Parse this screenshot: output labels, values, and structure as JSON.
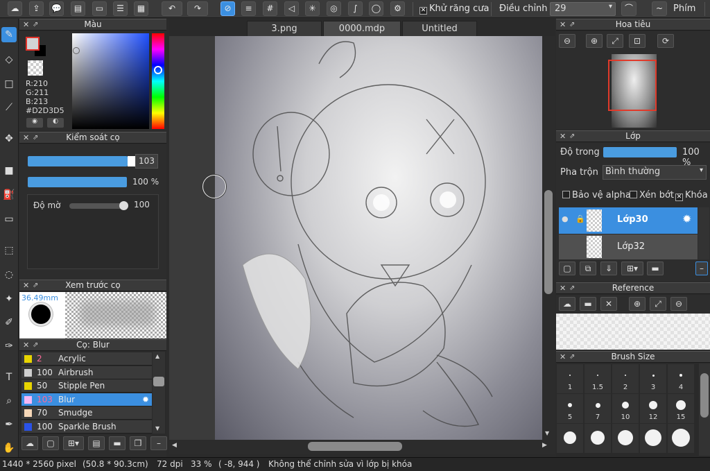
{
  "toolbar": {
    "antialias_label": "Khử răng cưa",
    "adjust_label": "Điều chỉnh",
    "adjust_value": "29",
    "shortcut_label": "Phím"
  },
  "color_panel": {
    "title": "Màu",
    "r_label": "R:210",
    "g_label": "G:211",
    "b_label": "B:213",
    "hex_label": "#D2D3D5",
    "current_color": "#d2d3d5"
  },
  "brush_control": {
    "title": "Kiểm soát cọ",
    "size_value": "103",
    "opacity_value": "100 %",
    "blur_label": "Độ mờ",
    "blur_value": "100"
  },
  "brush_preview": {
    "title": "Xem trước cọ",
    "size_text": "36.49mm"
  },
  "brush_list": {
    "title": "Cọ: Blur",
    "items": [
      {
        "size": "2",
        "name": "Acrylic",
        "color": "#e8d400"
      },
      {
        "size": "100",
        "name": "Airbrush",
        "color": "#cfcfcf"
      },
      {
        "size": "50",
        "name": "Stipple Pen",
        "color": "#e8d400"
      },
      {
        "size": "103",
        "name": "Blur",
        "color": "#f5b8f5",
        "selected": true
      },
      {
        "size": "70",
        "name": "Smudge",
        "color": "#f6d7b8"
      },
      {
        "size": "100",
        "name": "Sparkle Brush",
        "color": "#2a52e8"
      }
    ]
  },
  "tabs": [
    {
      "label": "3.png"
    },
    {
      "label": "0000.mdp",
      "active": true
    },
    {
      "label": "Untitled"
    }
  ],
  "navigator": {
    "title": "Hoa tiêu"
  },
  "layers": {
    "title": "Lớp",
    "opacity_label": "Độ trong",
    "opacity_value": "100 %",
    "blend_label": "Pha trộn",
    "blend_value": "Bình thường",
    "protect_alpha": "Bảo vệ alpha",
    "clipping": "Xén bớt",
    "lock": "Khóa",
    "items": [
      {
        "name": "Lớp30",
        "selected": true
      },
      {
        "name": "Lớp32"
      }
    ]
  },
  "reference": {
    "title": "Reference"
  },
  "brush_size": {
    "title": "Brush Size",
    "sizes": [
      "1",
      "1.5",
      "2",
      "3",
      "4",
      "5",
      "7",
      "10",
      "12",
      "15"
    ]
  },
  "status": {
    "dimensions": "1440 * 2560 pixel",
    "physical": "(50.8 * 90.3cm)",
    "dpi": "72 dpi",
    "zoom": "33 %",
    "coords": "( -8, 944 )",
    "message": "Không thể chỉnh sửa vì lớp bị khóa"
  }
}
